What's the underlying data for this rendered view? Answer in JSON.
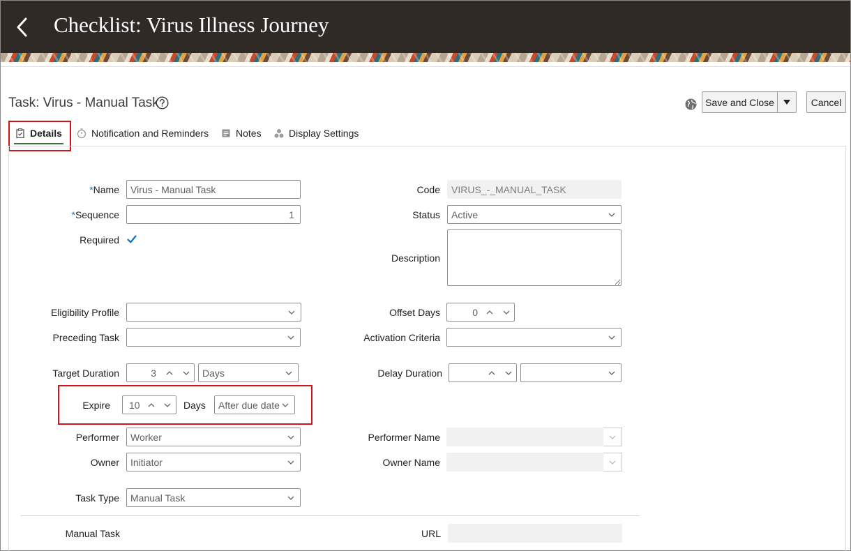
{
  "header": {
    "title": "Checklist: Virus Illness Journey"
  },
  "task": {
    "title": "Task: Virus - Manual Task"
  },
  "toolbar": {
    "save_close_label": "Save and Close",
    "cancel_label": "Cancel"
  },
  "tabs": [
    {
      "label": "Details",
      "icon": "clipboard-icon",
      "selected": true
    },
    {
      "label": "Notification and Reminders",
      "icon": "stopwatch-icon"
    },
    {
      "label": "Notes",
      "icon": "note-icon"
    },
    {
      "label": "Display Settings",
      "icon": "shapes-icon"
    }
  ],
  "form": {
    "name": {
      "label": "Name",
      "required_mark": "*",
      "value": "Virus - Manual Task"
    },
    "sequence": {
      "label": "Sequence",
      "required_mark": "*",
      "value": "1"
    },
    "required": {
      "label": "Required",
      "checked": true
    },
    "code": {
      "label": "Code",
      "value": "VIRUS_-_MANUAL_TASK"
    },
    "status": {
      "label": "Status",
      "value": "Active"
    },
    "description": {
      "label": "Description",
      "value": ""
    },
    "eligibility_profile": {
      "label": "Eligibility Profile",
      "value": ""
    },
    "offset_days": {
      "label": "Offset Days",
      "value": "0"
    },
    "preceding_task": {
      "label": "Preceding Task",
      "value": ""
    },
    "activation_criteria": {
      "label": "Activation Criteria",
      "value": ""
    },
    "target_duration": {
      "label": "Target Duration",
      "value": "3",
      "unit": "Days"
    },
    "delay_duration": {
      "label": "Delay Duration",
      "value": "",
      "unit": ""
    },
    "expire": {
      "label": "Expire",
      "value": "10",
      "unit_label": "Days",
      "relative": "After due date"
    },
    "performer": {
      "label": "Performer",
      "value": "Worker"
    },
    "performer_name": {
      "label": "Performer Name",
      "value": ""
    },
    "owner": {
      "label": "Owner",
      "value": "Initiator"
    },
    "owner_name": {
      "label": "Owner Name",
      "value": ""
    },
    "task_type": {
      "label": "Task Type",
      "value": "Manual Task"
    },
    "manual_task": {
      "label": "Manual Task"
    },
    "url": {
      "label": "URL",
      "value": ""
    }
  },
  "colors": {
    "header_bg": "#302a26",
    "highlight": "#d0141c",
    "required": "#0572ce",
    "tab_underline": "#3f6f3a"
  }
}
